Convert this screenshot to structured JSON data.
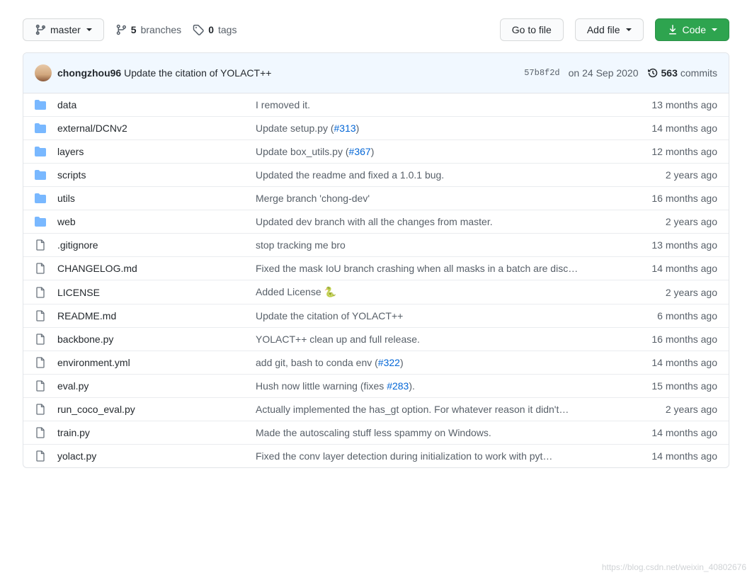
{
  "branch": {
    "name": "master"
  },
  "stats": {
    "branches_count": "5",
    "branches_label": "branches",
    "tags_count": "0",
    "tags_label": "tags"
  },
  "actions": {
    "go_to_file": "Go to file",
    "add_file": "Add file",
    "code": "Code"
  },
  "latest_commit": {
    "author": "chongzhou96",
    "message": "Update the citation of YOLACT++",
    "sha": "57b8f2d",
    "date": "on 24 Sep 2020",
    "commits_count": "563",
    "commits_label": "commits"
  },
  "files": [
    {
      "type": "folder",
      "name": "data",
      "message": "I removed it.",
      "time": "13 months ago"
    },
    {
      "type": "folder",
      "name": "external/DCNv2",
      "message": "Update setup.py (",
      "issue": "#313",
      "tail": ")",
      "time": "14 months ago"
    },
    {
      "type": "folder",
      "name": "layers",
      "message": "Update box_utils.py (",
      "issue": "#367",
      "tail": ")",
      "time": "12 months ago"
    },
    {
      "type": "folder",
      "name": "scripts",
      "message": "Updated the readme and fixed a 1.0.1 bug.",
      "time": "2 years ago"
    },
    {
      "type": "folder",
      "name": "utils",
      "message": "Merge branch 'chong-dev'",
      "time": "16 months ago"
    },
    {
      "type": "folder",
      "name": "web",
      "message": "Updated dev branch with all the changes from master.",
      "time": "2 years ago"
    },
    {
      "type": "file",
      "name": ".gitignore",
      "message": "stop tracking me bro",
      "time": "13 months ago"
    },
    {
      "type": "file",
      "name": "CHANGELOG.md",
      "message": "Fixed the mask IoU branch crashing when all masks in a batch are disc…",
      "time": "14 months ago"
    },
    {
      "type": "file",
      "name": "LICENSE",
      "message": "Added License 🐍",
      "time": "2 years ago"
    },
    {
      "type": "file",
      "name": "README.md",
      "message": "Update the citation of YOLACT++",
      "time": "6 months ago"
    },
    {
      "type": "file",
      "name": "backbone.py",
      "message": "YOLACT++ clean up and full release.",
      "time": "16 months ago"
    },
    {
      "type": "file",
      "name": "environment.yml",
      "message": "add git, bash to conda env (",
      "issue": "#322",
      "tail": ")",
      "time": "14 months ago"
    },
    {
      "type": "file",
      "name": "eval.py",
      "message": "Hush now little warning (",
      "fixes": "fixes ",
      "issue": "#283",
      "tail": ").",
      "time": "15 months ago"
    },
    {
      "type": "file",
      "name": "run_coco_eval.py",
      "message": "Actually implemented the has_gt option. For whatever reason it didn't…",
      "time": "2 years ago"
    },
    {
      "type": "file",
      "name": "train.py",
      "message": "Made the autoscaling stuff less spammy on Windows.",
      "time": "14 months ago"
    },
    {
      "type": "file",
      "name": "yolact.py",
      "message": "Fixed the conv layer detection during initialization to work with pyt…",
      "time": "14 months ago"
    }
  ],
  "watermark": "https://blog.csdn.net/weixin_40802676"
}
